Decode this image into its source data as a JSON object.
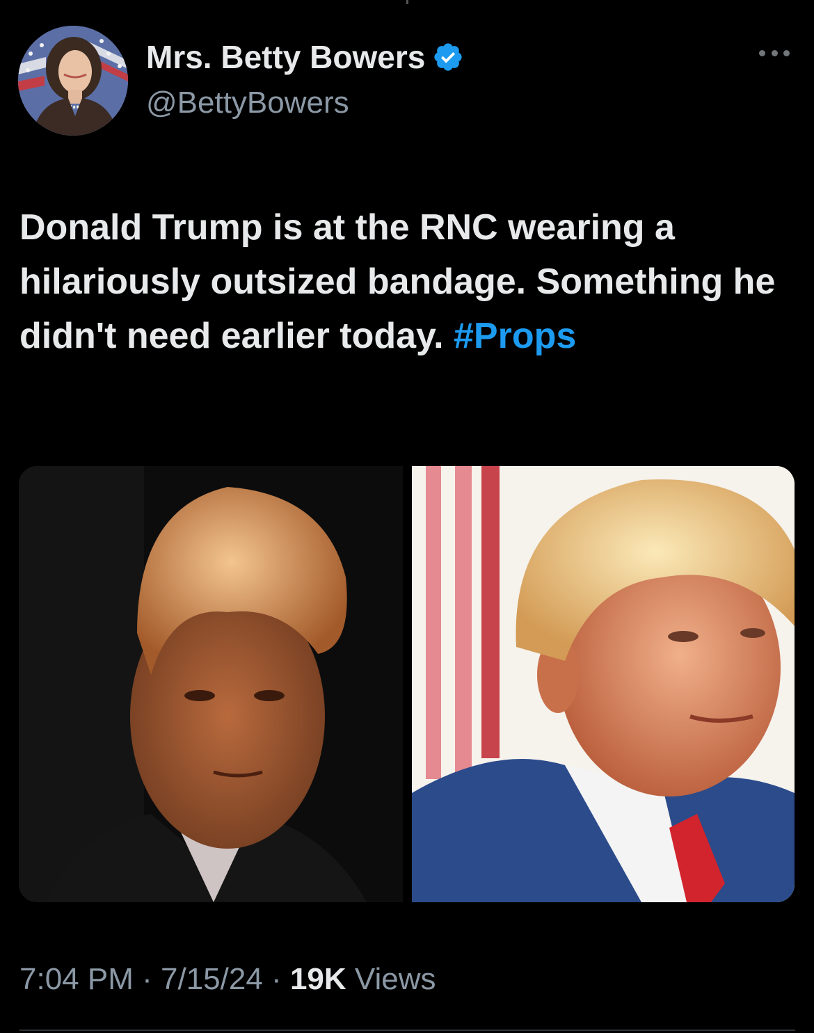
{
  "author": {
    "display_name": "Mrs. Betty Bowers",
    "handle": "@BettyBowers",
    "verified": true,
    "avatar_icon": "profile-photo-woman-flag-backdrop"
  },
  "tweet": {
    "text": "Donald Trump is at the RNC wearing a hilariously outsized bandage. Something he didn't need earlier today.",
    "hashtag": "#Props"
  },
  "media": {
    "images": [
      {
        "icon": "photo-man-orange-hair-dark-background"
      },
      {
        "icon": "photo-man-blue-suit-red-tie-flag-background"
      }
    ]
  },
  "meta": {
    "time": "7:04 PM",
    "separator": "·",
    "date": "7/15/24",
    "views_count": "19K",
    "views_label": "Views"
  },
  "colors": {
    "background": "#000000",
    "text": "#e7e9ea",
    "secondary": "#8b98a5",
    "link": "#1d9bf0",
    "verified": "#1d9bf0"
  }
}
